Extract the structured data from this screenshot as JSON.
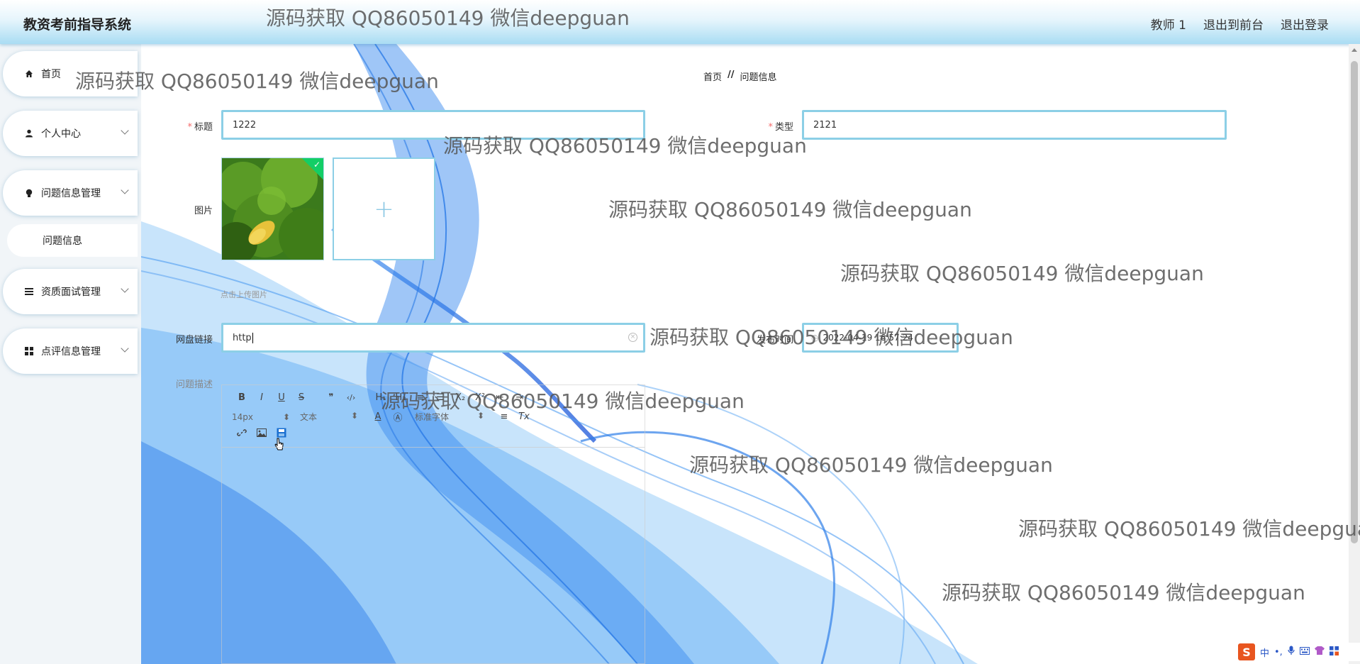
{
  "header": {
    "brand": "教资考前指导系统",
    "user": "教师 1",
    "to_front": "退出到前台",
    "logout": "退出登录"
  },
  "sidebar": {
    "items": [
      {
        "label": "首页",
        "icon": "home-icon"
      },
      {
        "label": "个人中心",
        "icon": "user-icon"
      },
      {
        "label": "问题信息管理",
        "icon": "bulb-icon"
      },
      {
        "label": "问题信息",
        "icon": ""
      },
      {
        "label": "资质面试管理",
        "icon": "list-icon"
      },
      {
        "label": "点评信息管理",
        "icon": "grid-icon"
      }
    ]
  },
  "breadcrumb": {
    "home": "首页",
    "sep": "//",
    "current": "问题信息"
  },
  "form": {
    "title_label": "标题",
    "title_value": "1222",
    "type_label": "类型",
    "type_value": "2121",
    "image_label": "图片",
    "upload_plus": "+",
    "upload_tip": "点击上传图片",
    "link_label": "网盘链接",
    "link_value": "http",
    "time_label": "发布时间",
    "time_value": "2022-04-19 16:57:24",
    "desc_label": "问题描述"
  },
  "editor": {
    "bold": "B",
    "italic": "I",
    "underline": "U",
    "strike": "S",
    "quote": "❞",
    "code": "‹/›",
    "h1": "H₁",
    "h2": "H₂",
    "ol": "≡",
    "ul": "☰",
    "sub": "X₂",
    "sup": "X²",
    "indent_less": "⇤",
    "indent_more": "⇥",
    "size": "14px",
    "format": "文本",
    "font": "标准字体",
    "clean": "Tx",
    "color": "A",
    "bg_color": "Ⓐ",
    "align": "≡"
  },
  "watermark": "源码获取 QQ86050149 微信deepguan",
  "ime": {
    "logo": "S",
    "lang": "中"
  }
}
